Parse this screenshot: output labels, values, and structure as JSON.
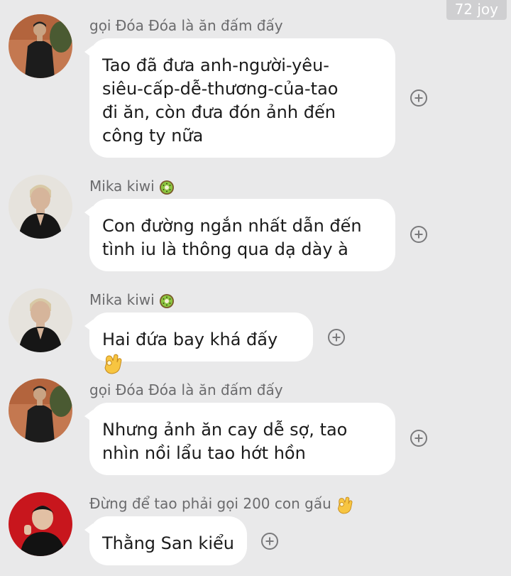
{
  "watermark": "72 joy",
  "messages": [
    {
      "sender": "gọi Đóa Đóa là ăn đấm đấy",
      "lines": [
        "Tao đã đưa anh-người-yêu-",
        "siêu-cấp-dễ-thương-của-tao",
        "đi ăn, còn đưa đón ảnh đến",
        "công ty nữa"
      ],
      "avatar_icon": "man-in-black-portrait-avatar"
    },
    {
      "sender": "Mika kiwi",
      "sender_icon": "kiwi-icon",
      "lines": [
        "Con đường ngắn nhất dẫn đến",
        "tình iu là thông qua dạ dày à"
      ],
      "avatar_icon": "blond-man-avatar"
    },
    {
      "sender": "Mika kiwi",
      "sender_icon": "kiwi-icon",
      "lines": [
        "Hai đứa bay khá đấy"
      ],
      "text_icon": "ok-hand-emoji",
      "avatar_icon": "blond-man-avatar"
    },
    {
      "sender": "gọi Đóa Đóa là ăn đấm đấy",
      "lines": [
        "Nhưng ảnh ăn cay dễ sợ, tao",
        "nhìn nồi lẩu tao hớt hồn"
      ],
      "avatar_icon": "man-in-black-portrait-avatar"
    },
    {
      "sender": "Đừng để tao phải gọi 200 con gấu",
      "sender_icon": "ok-hand-emoji",
      "lines": [
        "Thằng San kiểu"
      ],
      "avatar_icon": "man-on-red-background-avatar"
    }
  ],
  "colors": {
    "background": "#e9e9ea",
    "bubble": "#ffffff",
    "sender_text": "#6b6b6d",
    "icon_gray": "#7a7a7c"
  }
}
